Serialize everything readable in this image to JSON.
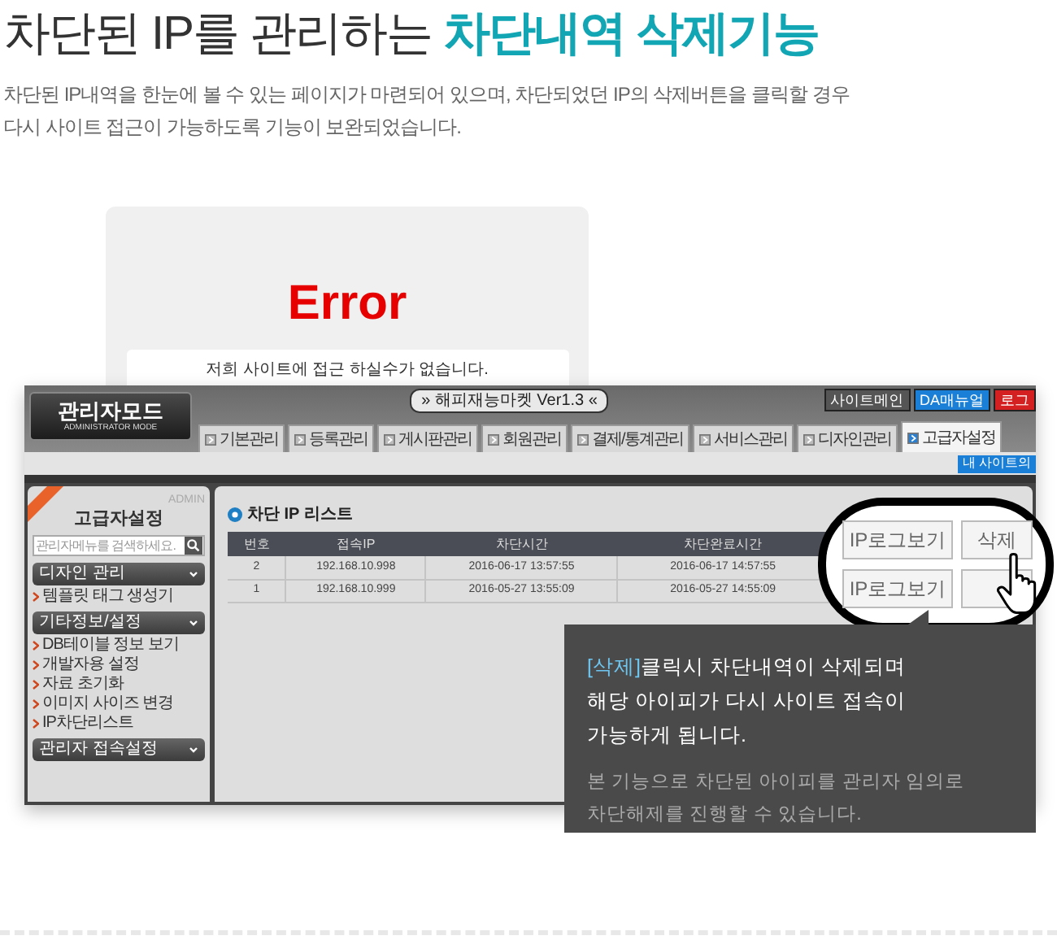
{
  "headline": "차단된 IP를 관리하는 **차단내역 삭제기능**",
  "description_lines": [
    "차단된 IP내역을 한눈에 볼 수 있는 페이지가 마련되어 있으며, 차단되었던 IP의 삭제버튼을 클릭할 경우",
    "다시 사이트 접근이 가능하도록 기능이 보완되었습니다."
  ],
  "error_page": {
    "title": "Error",
    "message": "저희 사이트에 접근 하실수가 없습니다."
  },
  "admin": {
    "logo_title": "관리자모드",
    "logo_subtitle": "ADMINISTRATOR MODE",
    "site_title": "» 해피재능마켓 Ver1.3 «",
    "top_buttons": [
      {
        "label": "사이트메인",
        "color": "#555555"
      },
      {
        "label": "DA매뉴얼",
        "color": "#1a7fd6"
      },
      {
        "label": "로그",
        "color": "#d42020"
      }
    ],
    "tabs": [
      {
        "label": "기본관리",
        "selected": false
      },
      {
        "label": "등록관리",
        "selected": false
      },
      {
        "label": "게시판관리",
        "selected": false
      },
      {
        "label": "회원관리",
        "selected": false
      },
      {
        "label": "결제/통계관리",
        "selected": false
      },
      {
        "label": "서비스관리",
        "selected": false
      },
      {
        "label": "디자인관리",
        "selected": false
      },
      {
        "label": "고급자설정",
        "selected": true
      }
    ],
    "my_site_button": "내 사이트의",
    "sidebar": {
      "brand": "ADMIN",
      "title": "고급자설정",
      "search_placeholder": "관리자메뉴를 검색하세요.",
      "sections": [
        {
          "title": "디자인 관리",
          "items": [
            "템플릿 태그 생성기"
          ]
        },
        {
          "title": "기타정보/설정",
          "items": [
            "DB테이블 정보 보기",
            "개발자용 설정",
            "자료 초기화",
            "이미지 사이즈 변경",
            "IP차단리스트"
          ]
        },
        {
          "title": "관리자 접속설정"
        }
      ]
    },
    "list": {
      "title": "차단 IP 리스트",
      "columns": [
        "번호",
        "접속IP",
        "차단시간",
        "차단완료시간"
      ],
      "rows": [
        [
          "2",
          "192.168.10.998",
          "2016-06-17 13:57:55",
          "2016-06-17 14:57:55"
        ],
        [
          "1",
          "192.168.10.999",
          "2016-05-27 13:55:09",
          "2016-05-27 14:55:09"
        ]
      ]
    }
  },
  "magnifier": {
    "rows": [
      [
        "IP로그보기",
        "삭제"
      ],
      [
        "IP로그보기"
      ]
    ]
  },
  "callout": {
    "text": "**[삭제]**클릭시 차단내역이 삭제되며 해당 아이피가 다시 사이트 접속이 가능하게 됩니다.",
    "note": "본 기능으로 차단된 아이피를 관리자 임의로 차단해제를 진행할 수 있습니다."
  }
}
